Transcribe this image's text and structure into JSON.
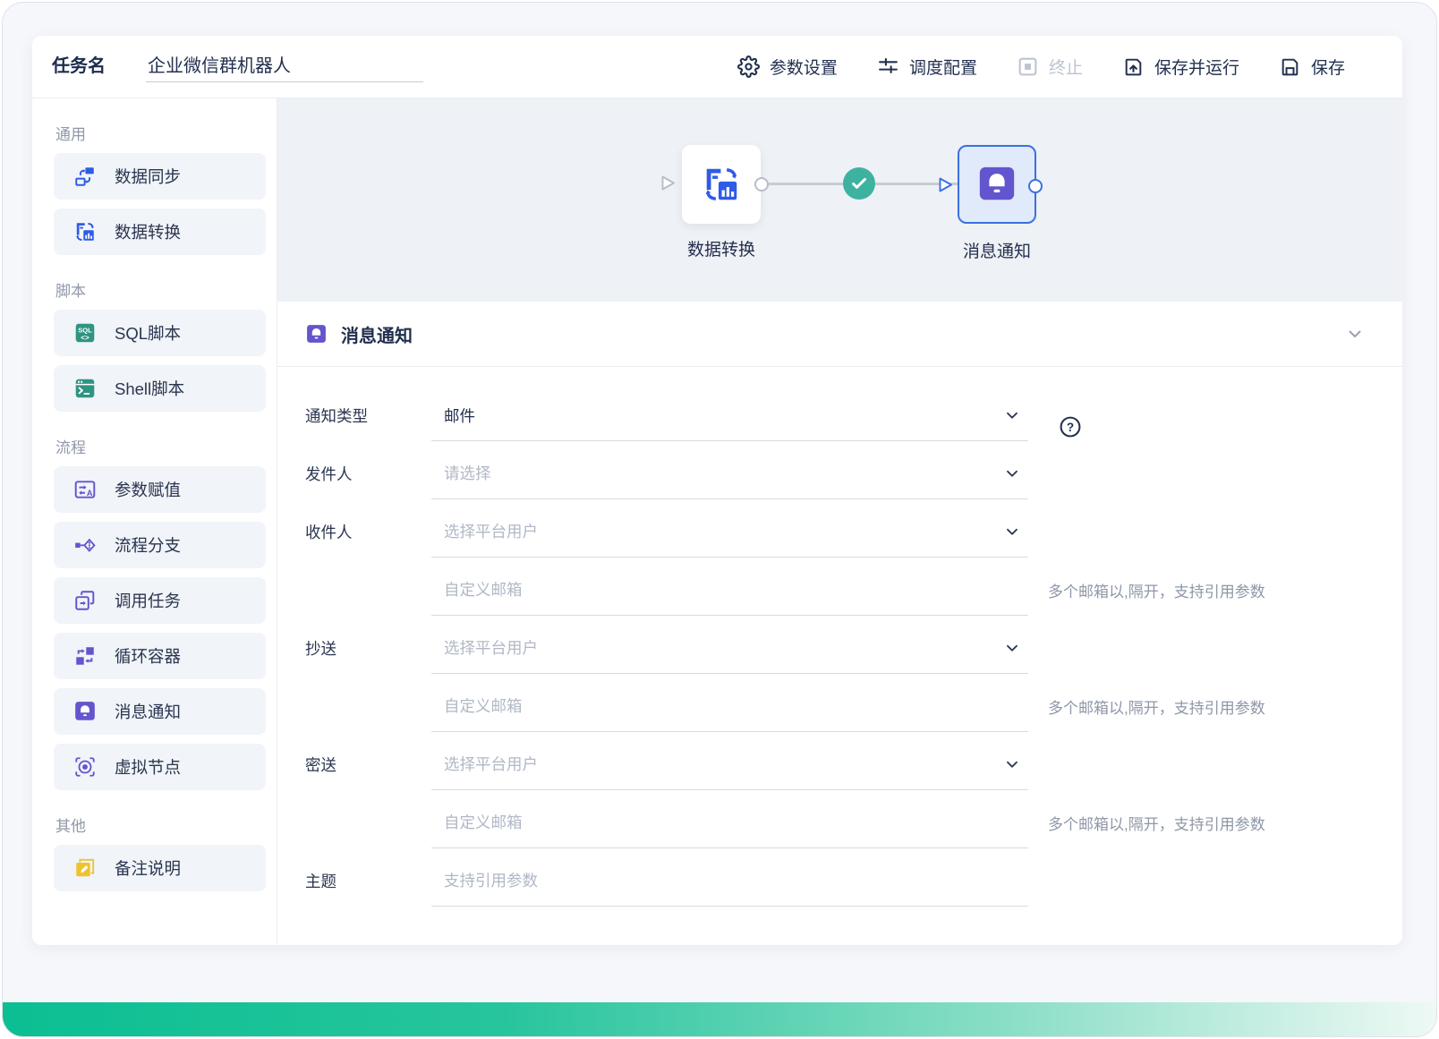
{
  "topbar": {
    "task_name_label": "任务名",
    "task_name_value": "企业微信群机器人",
    "actions": [
      {
        "label": "参数设置",
        "icon": "gear-icon",
        "enabled": true
      },
      {
        "label": "调度配置",
        "icon": "sliders-icon",
        "enabled": true
      },
      {
        "label": "终止",
        "icon": "stop-icon",
        "enabled": false
      },
      {
        "label": "保存并运行",
        "icon": "save-run-icon",
        "enabled": true
      },
      {
        "label": "保存",
        "icon": "save-icon",
        "enabled": true
      }
    ]
  },
  "sidebar": {
    "sections": [
      {
        "label": "通用",
        "items": [
          {
            "label": "数据同步",
            "icon": "data-sync-icon",
            "color": "#2e5ce6"
          },
          {
            "label": "数据转换",
            "icon": "data-transform-icon",
            "color": "#2e5ce6"
          }
        ]
      },
      {
        "label": "脚本",
        "items": [
          {
            "label": "SQL脚本",
            "icon": "sql-script-icon",
            "color": "#2f9482"
          },
          {
            "label": "Shell脚本",
            "icon": "shell-script-icon",
            "color": "#2f9482"
          }
        ]
      },
      {
        "label": "流程",
        "items": [
          {
            "label": "参数赋值",
            "icon": "param-assign-icon",
            "color": "#6355cd"
          },
          {
            "label": "流程分支",
            "icon": "branch-icon",
            "color": "#6355cd"
          },
          {
            "label": "调用任务",
            "icon": "call-task-icon",
            "color": "#6355cd"
          },
          {
            "label": "循环容器",
            "icon": "loop-container-icon",
            "color": "#6355cd"
          },
          {
            "label": "消息通知",
            "icon": "bell-icon",
            "color": "#6355cd"
          },
          {
            "label": "虚拟节点",
            "icon": "virtual-node-icon",
            "color": "#6355cd"
          }
        ]
      },
      {
        "label": "其他",
        "items": [
          {
            "label": "备注说明",
            "icon": "note-icon",
            "color": "#eec32f"
          }
        ]
      }
    ]
  },
  "canvas": {
    "nodes": [
      {
        "label": "数据转换",
        "icon": "data-transform-icon",
        "selected": false
      },
      {
        "label": "消息通知",
        "icon": "bell-icon",
        "selected": true
      }
    ],
    "edge": {
      "status": "success",
      "status_icon": "check-icon",
      "status_color": "#3eb2a1"
    }
  },
  "panel": {
    "title": "消息通知",
    "icon": "bell-icon"
  },
  "form": {
    "rows": [
      {
        "label": "通知类型",
        "value": "邮件",
        "control": "select",
        "help_icon": "question-icon"
      },
      {
        "label": "发件人",
        "placeholder": "请选择",
        "control": "select"
      },
      {
        "label": "收件人",
        "placeholder": "选择平台用户",
        "control": "select"
      },
      {
        "label": "",
        "placeholder": "自定义邮箱",
        "control": "input",
        "hint": "多个邮箱以,隔开，支持引用参数"
      },
      {
        "label": "抄送",
        "placeholder": "选择平台用户",
        "control": "select"
      },
      {
        "label": "",
        "placeholder": "自定义邮箱",
        "control": "input",
        "hint": "多个邮箱以,隔开，支持引用参数"
      },
      {
        "label": "密送",
        "placeholder": "选择平台用户",
        "control": "select"
      },
      {
        "label": "",
        "placeholder": "自定义邮箱",
        "control": "input",
        "hint": "多个邮箱以,隔开，支持引用参数"
      },
      {
        "label": "主题",
        "placeholder": "支持引用参数",
        "control": "input"
      }
    ]
  },
  "colors": {
    "accent_blue": "#2e5ce6",
    "accent_purple": "#6355cd",
    "accent_teal": "#2f9482",
    "accent_yellow": "#eec32f",
    "success_green": "#3eb2a1",
    "selected_node_border": "#3c6fe2",
    "text_primary": "#22304f",
    "text_muted": "#8f98a9",
    "bottom_bar_gradient_start": "#0bbf92"
  }
}
